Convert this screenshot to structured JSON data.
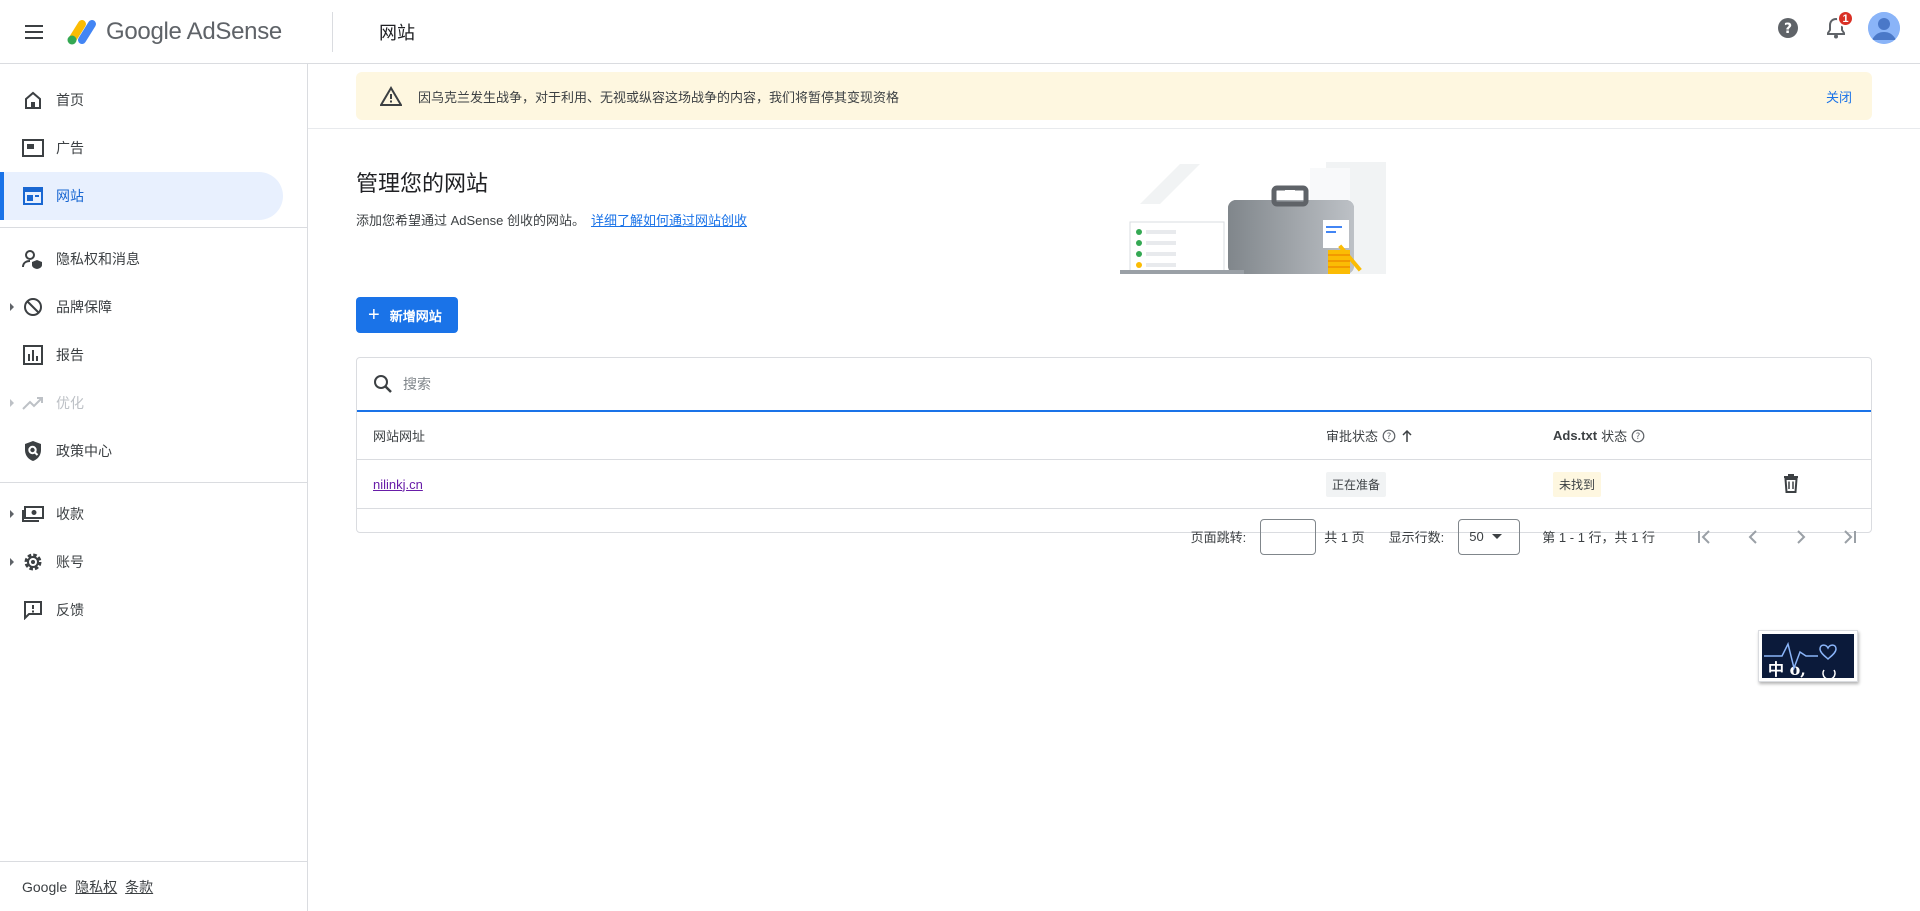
{
  "app": {
    "logo_text": "Google AdSense",
    "page_heading": "网站"
  },
  "topbar": {
    "notification_count": "1"
  },
  "sidebar": {
    "items": [
      {
        "label": "首页"
      },
      {
        "label": "广告"
      },
      {
        "label": "网站"
      },
      {
        "label": "隐私权和消息"
      },
      {
        "label": "品牌保障"
      },
      {
        "label": "报告"
      },
      {
        "label": "优化"
      },
      {
        "label": "政策中心"
      },
      {
        "label": "收款"
      },
      {
        "label": "账号"
      },
      {
        "label": "反馈"
      }
    ],
    "footer": {
      "brand": "Google",
      "privacy": "隐私权",
      "terms": "条款"
    }
  },
  "alert": {
    "text": "因乌克兰发生战争，对于利用、无视或纵容这场战争的内容，我们将暂停其变现资格",
    "close": "关闭"
  },
  "main": {
    "title": "管理您的网站",
    "subtitle": "添加您希望通过 AdSense 创收的网站。",
    "learn_more": "详细了解如何通过网站创收",
    "add_button": "新增网站"
  },
  "table": {
    "search_placeholder": "搜索",
    "headers": {
      "site": "网站网址",
      "review": "审批状态",
      "ads_txt_bold": "Ads.txt",
      "ads_txt_suffix": "状态"
    },
    "rows": [
      {
        "site": "nilinkj.cn",
        "review": "正在准备",
        "ads_txt": "未找到"
      }
    ],
    "pager": {
      "jump_label": "页面跳转:",
      "total_pages": "共 1 页",
      "rows_label": "显示行数:",
      "rows_value": "50",
      "range": "第 1 - 1 行，共 1 行"
    }
  },
  "ime": {
    "text": "中 o,"
  },
  "colors": {
    "primary": "#1a73e8",
    "alert_bg": "#fef7e0",
    "active_nav_bg": "#e8f0fe"
  }
}
